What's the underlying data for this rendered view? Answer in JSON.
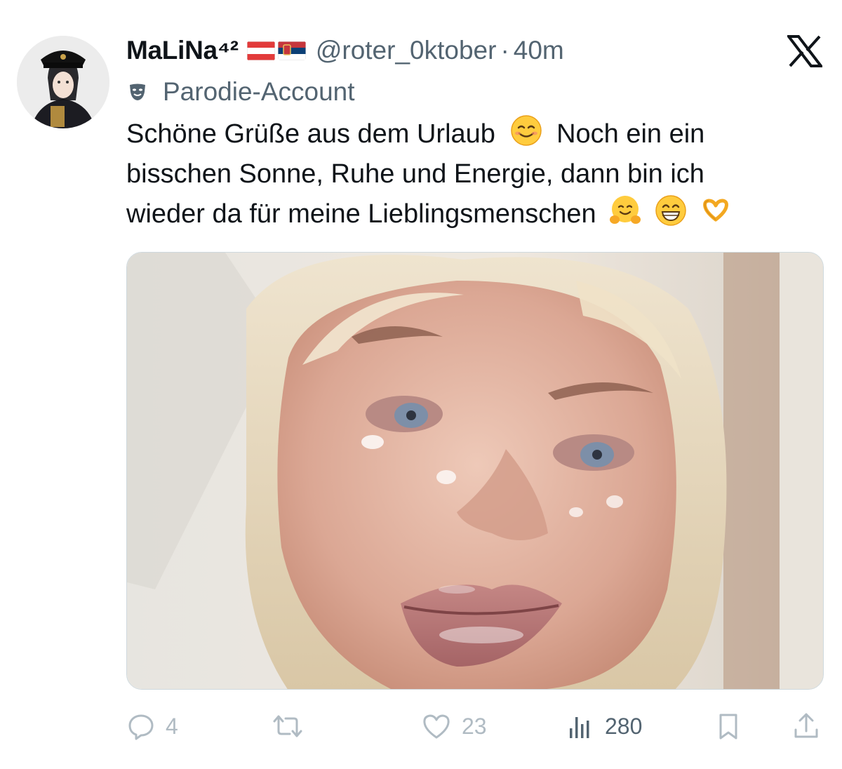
{
  "author": {
    "display_name": "MaLiNa⁴²",
    "handle": "@roter_0ktober",
    "separator": "·",
    "time": "40m",
    "flags": [
      "austria-flag",
      "serbia-flag"
    ],
    "label": "Parodie-Account"
  },
  "tweet": {
    "line1_a": "Schöne Grüße aus dem Urlaub",
    "line1_b": "Noch ein ein",
    "line2": "bisschen Sonne, Ruhe und Energie, dann bin ich",
    "line3": "wieder da für meine Lieblingsmenschen",
    "emojis": [
      "smiling-face-emoji",
      "hugging-face-emoji",
      "grinning-face-emoji",
      "heart-hands-emoji"
    ]
  },
  "media": {
    "type": "photo",
    "subject": "close-up selfie of face with blonde hair"
  },
  "actions": {
    "replies": "4",
    "reposts": "",
    "likes": "23",
    "views": "280"
  },
  "icons": {
    "platform": "x-logo-icon",
    "parody": "theater-mask-icon"
  },
  "colors": {
    "text": "#0f1419",
    "secondary": "#536471",
    "muted_action": "#b0bbc3",
    "border": "#cfd9de"
  }
}
